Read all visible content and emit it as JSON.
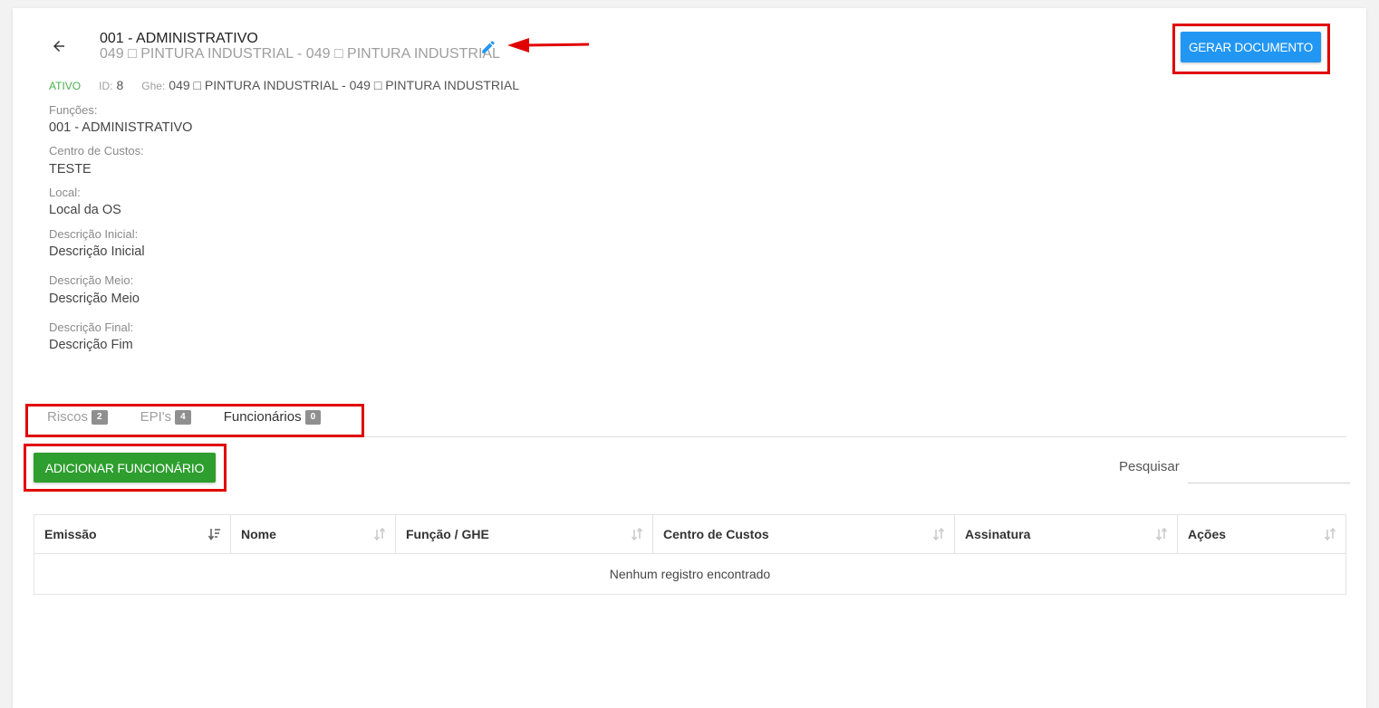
{
  "header": {
    "title": "001 - ADMINISTRATIVO",
    "subtitle": "049 □ PINTURA INDUSTRIAL - 049 □ PINTURA INDUSTRIAL",
    "action_label": "GERAR DOCUMENTO"
  },
  "meta": {
    "status": "ATIVO",
    "id_label": "ID:",
    "id_value": "8",
    "ghe_label": "Ghe:",
    "ghe_value": "049 □ PINTURA INDUSTRIAL - 049 □ PINTURA INDUSTRIAL"
  },
  "fields": {
    "funcoes_label": "Funções:",
    "funcoes_value": "001 - ADMINISTRATIVO",
    "centro_label": "Centro de Custos:",
    "centro_value": "TESTE",
    "local_label": "Local:",
    "local_value": "Local da OS",
    "desc_inicial_label": "Descrição Inicial:",
    "desc_inicial_value": "Descrição Inicial",
    "desc_meio_label": "Descrição Meio:",
    "desc_meio_value": "Descrição Meio",
    "desc_final_label": "Descrição Final:",
    "desc_final_value": "Descrição Fim"
  },
  "tabs": [
    {
      "label": "Riscos",
      "count": "2"
    },
    {
      "label": "EPI's",
      "count": "4"
    },
    {
      "label": "Funcionários",
      "count": "0"
    }
  ],
  "toolbar": {
    "add_label": "ADICIONAR FUNCIONÁRIO",
    "search_label": "Pesquisar",
    "search_value": ""
  },
  "table": {
    "columns": [
      "Emissão",
      "Nome",
      "Função / GHE",
      "Centro de Custos",
      "Assinatura",
      "Ações"
    ],
    "empty_message": "Nenhum registro encontrado"
  },
  "colors": {
    "primary": "#2196f3",
    "success": "#2e9e2e",
    "status_active": "#4caf50",
    "annotation": "#e00000"
  },
  "icons": [
    "back-arrow-icon",
    "pencil-icon",
    "sort-desc-icon",
    "sort-both-icon"
  ]
}
